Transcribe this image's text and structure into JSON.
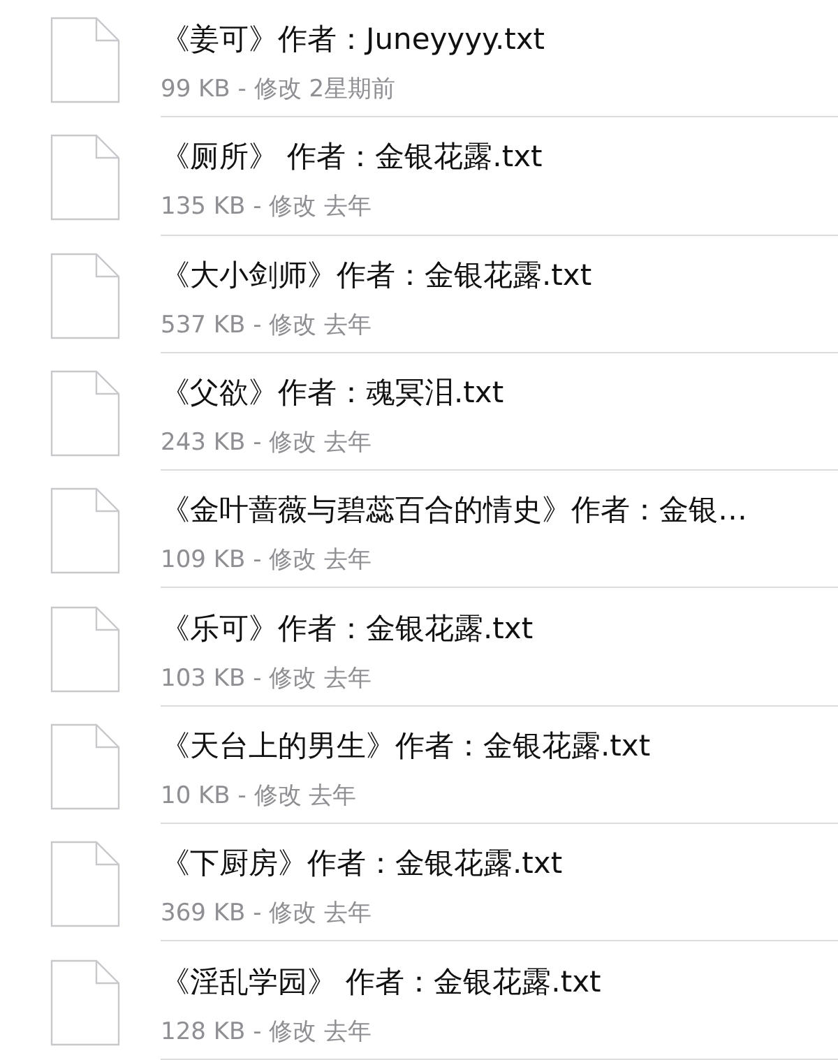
{
  "files": [
    {
      "name": "《姜可》作者：Juneyyyy.txt",
      "details": "99 KB - 修改 2星期前"
    },
    {
      "name": "《厕所》 作者：金银花露.txt",
      "details": "135 KB - 修改 去年"
    },
    {
      "name": "《大小剑师》作者：金银花露.txt",
      "details": "537 KB - 修改 去年"
    },
    {
      "name": "《父欲》作者：魂冥泪.txt",
      "details": "243 KB - 修改 去年"
    },
    {
      "name": "《金叶蔷薇与碧蕊百合的情史》作者：金银…",
      "details": "109 KB - 修改 去年"
    },
    {
      "name": "《乐可》作者：金银花露.txt",
      "details": "103 KB - 修改 去年"
    },
    {
      "name": "《天台上的男生》作者：金银花露.txt",
      "details": "10 KB - 修改 去年"
    },
    {
      "name": "《下厨房》作者：金银花露.txt",
      "details": "369 KB - 修改 去年"
    },
    {
      "name": "《淫乱学园》 作者：金银花露.txt",
      "details": "128 KB - 修改 去年"
    }
  ]
}
